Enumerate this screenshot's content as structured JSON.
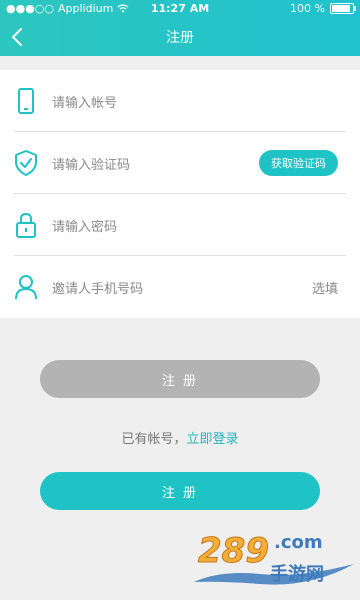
{
  "status_bar": {
    "carrier": "Applidium",
    "time": "11:27 AM",
    "battery_text": "100 %",
    "battery_level": 1.0
  },
  "nav": {
    "title": "注册",
    "back_icon": "chevron-left-icon"
  },
  "form": {
    "account_placeholder": "请输入帐号",
    "code_placeholder": "请输入验证码",
    "get_code_label": "获取验证码",
    "password_placeholder": "请输入密码",
    "invite_placeholder": "邀请人手机号码",
    "invite_optional": "选填"
  },
  "buttons": {
    "disabled_register_label": "注 册",
    "register_label": "注 册"
  },
  "login_prompt": {
    "text": "已有帐号，",
    "link": "立即登录"
  },
  "watermark": {
    "text": "289.com",
    "subtext": "手游网"
  },
  "colors": {
    "accent": "#1fc3c5",
    "accent_dark": "#25b3c2",
    "disabled": "#b3b3b3",
    "background": "#efefef"
  }
}
